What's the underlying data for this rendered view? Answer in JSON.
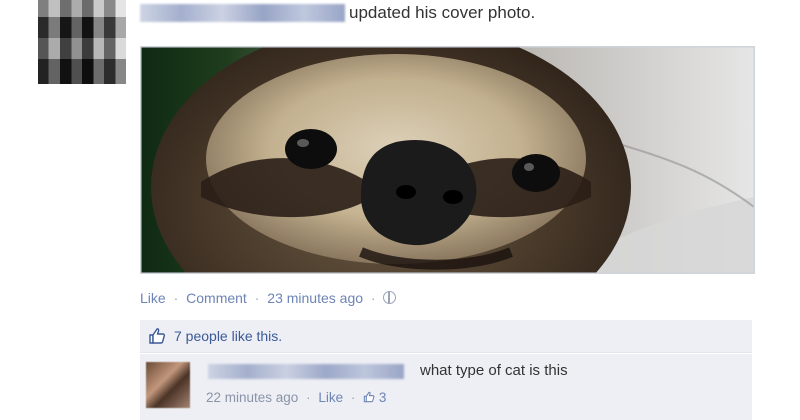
{
  "post": {
    "action_text": "updated his cover photo.",
    "meta": {
      "like_label": "Like",
      "comment_label": "Comment",
      "time": "23 minutes ago"
    },
    "likes": {
      "text": "7 people like this."
    }
  },
  "comment": {
    "text": "what type of cat is this",
    "time": "22 minutes ago",
    "like_label": "Like",
    "like_count": "3"
  },
  "colors": {
    "link": "#6d84b4",
    "likes_bg": "#edeff4"
  },
  "icons": {
    "privacy": "globe-icon",
    "likes": "thumbs-up-icon"
  }
}
